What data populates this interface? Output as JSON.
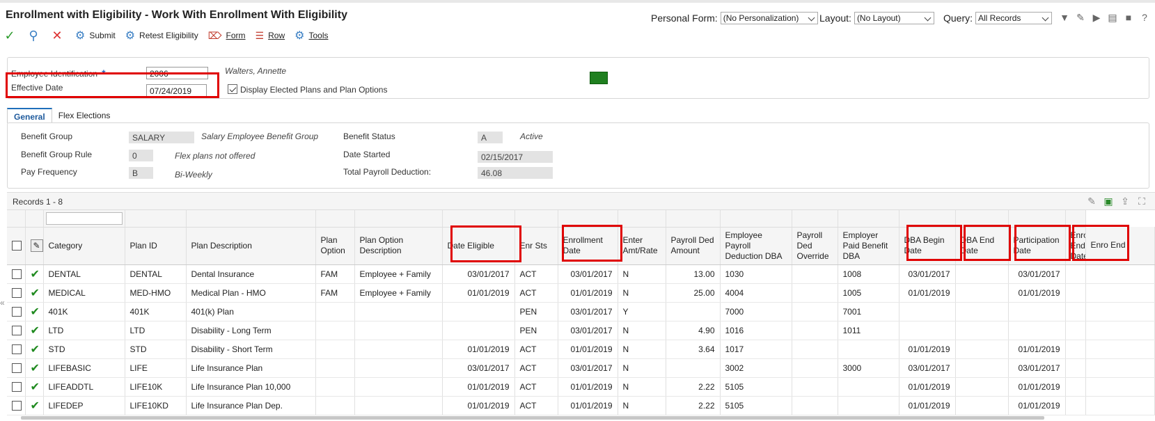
{
  "app": {
    "title": "Enrollment with Eligibility - Work With Enrollment With Eligibility",
    "personal_form_label": "Personal Form:",
    "personal_form_value": "(No Personalization)",
    "layout_label": "Layout:",
    "layout_value": "(No Layout)",
    "query_label": "Query:",
    "query_value": "All Records"
  },
  "toolbar": {
    "submit": "Submit",
    "retest": "Retest Eligibility",
    "form": "Form",
    "row": "Row",
    "tools": "Tools"
  },
  "header": {
    "emp_id_label": "Employee Identification",
    "emp_id_value": "2006",
    "emp_name": "Walters, Annette",
    "eff_date_label": "Effective Date",
    "eff_date_value": "07/24/2019",
    "display_elected_label": "Display Elected Plans and Plan Options"
  },
  "tabs": {
    "general": "General",
    "flex": "Flex Elections"
  },
  "general": {
    "benefit_group_label": "Benefit Group",
    "benefit_group_value": "SALARY",
    "benefit_group_desc": "Salary Employee Benefit Group",
    "benefit_rule_label": "Benefit Group Rule",
    "benefit_rule_value": "0",
    "benefit_rule_desc": "Flex plans not offered",
    "pay_freq_label": "Pay Frequency",
    "pay_freq_value": "B",
    "pay_freq_desc": "Bi-Weekly",
    "benefit_status_label": "Benefit Status",
    "benefit_status_value": "A",
    "benefit_status_desc": "Active",
    "date_started_label": "Date Started",
    "date_started_value": "02/15/2017",
    "total_payroll_label": "Total Payroll Deduction:",
    "total_payroll_value": "46.08"
  },
  "grid": {
    "records_label": "Records 1 - 8",
    "columns": {
      "category": "Category",
      "plan_id": "Plan ID",
      "plan_desc": "Plan Description",
      "plan_option": "Plan Option",
      "plan_option_desc": "Plan Option Description",
      "date_eligible": "Date Eligible",
      "enr_sts": "Enr Sts",
      "enrollment_date": "Enrollment Date",
      "enter_amt": "Enter Amt/Rate",
      "payroll_ded_amt": "Payroll Ded Amount",
      "emp_payroll_dba": "Employee Payroll Deduction DBA",
      "payroll_ded_override": "Payroll Ded Override",
      "employer_paid_dba": "Employer Paid Benefit DBA",
      "dba_begin": "DBA Begin Date",
      "dba_end": "DBA End Date",
      "participation": "Participation Date",
      "enrollment_end": "Enrollment End Date",
      "enrollment_end_cut": "Enro End"
    },
    "rows": [
      {
        "category": "DENTAL",
        "plan_id": "DENTAL",
        "plan_desc": "Dental Insurance",
        "plan_option": "FAM",
        "plan_option_desc": "Employee + Family",
        "date_eligible": "03/01/2017",
        "enr_sts": "ACT",
        "enrollment_date": "03/01/2017",
        "enter_amt": "N",
        "payroll_ded_amt": "13.00",
        "emp_payroll_dba": "1030",
        "payroll_ded_override": "",
        "employer_paid_dba": "1008",
        "dba_begin": "03/01/2017",
        "dba_end": "",
        "participation": "03/01/2017",
        "enrollment_end": ""
      },
      {
        "category": "MEDICAL",
        "plan_id": "MED-HMO",
        "plan_desc": "Medical Plan - HMO",
        "plan_option": "FAM",
        "plan_option_desc": "Employee + Family",
        "date_eligible": "01/01/2019",
        "enr_sts": "ACT",
        "enrollment_date": "01/01/2019",
        "enter_amt": "N",
        "payroll_ded_amt": "25.00",
        "emp_payroll_dba": "4004",
        "payroll_ded_override": "",
        "employer_paid_dba": "1005",
        "dba_begin": "01/01/2019",
        "dba_end": "",
        "participation": "01/01/2019",
        "enrollment_end": ""
      },
      {
        "category": "401K",
        "plan_id": "401K",
        "plan_desc": "401(k) Plan",
        "plan_option": "",
        "plan_option_desc": "",
        "date_eligible": "",
        "enr_sts": "PEN",
        "enrollment_date": "03/01/2017",
        "enter_amt": "Y",
        "payroll_ded_amt": "",
        "emp_payroll_dba": "7000",
        "payroll_ded_override": "",
        "employer_paid_dba": "7001",
        "dba_begin": "",
        "dba_end": "",
        "participation": "",
        "enrollment_end": ""
      },
      {
        "category": "LTD",
        "plan_id": "LTD",
        "plan_desc": "Disability - Long Term",
        "plan_option": "",
        "plan_option_desc": "",
        "date_eligible": "",
        "enr_sts": "PEN",
        "enrollment_date": "03/01/2017",
        "enter_amt": "N",
        "payroll_ded_amt": "4.90",
        "emp_payroll_dba": "1016",
        "payroll_ded_override": "",
        "employer_paid_dba": "1011",
        "dba_begin": "",
        "dba_end": "",
        "participation": "",
        "enrollment_end": ""
      },
      {
        "category": "STD",
        "plan_id": "STD",
        "plan_desc": "Disability - Short Term",
        "plan_option": "",
        "plan_option_desc": "",
        "date_eligible": "01/01/2019",
        "enr_sts": "ACT",
        "enrollment_date": "01/01/2019",
        "enter_amt": "N",
        "payroll_ded_amt": "3.64",
        "emp_payroll_dba": "1017",
        "payroll_ded_override": "",
        "employer_paid_dba": "",
        "dba_begin": "01/01/2019",
        "dba_end": "",
        "participation": "01/01/2019",
        "enrollment_end": ""
      },
      {
        "category": "LIFEBASIC",
        "plan_id": "LIFE",
        "plan_desc": "Life Insurance Plan",
        "plan_option": "",
        "plan_option_desc": "",
        "date_eligible": "03/01/2017",
        "enr_sts": "ACT",
        "enrollment_date": "03/01/2017",
        "enter_amt": "N",
        "payroll_ded_amt": "",
        "emp_payroll_dba": "3002",
        "payroll_ded_override": "",
        "employer_paid_dba": "3000",
        "dba_begin": "03/01/2017",
        "dba_end": "",
        "participation": "03/01/2017",
        "enrollment_end": ""
      },
      {
        "category": "LIFEADDTL",
        "plan_id": "LIFE10K",
        "plan_desc": "Life Insurance Plan 10,000",
        "plan_option": "",
        "plan_option_desc": "",
        "date_eligible": "01/01/2019",
        "enr_sts": "ACT",
        "enrollment_date": "01/01/2019",
        "enter_amt": "N",
        "payroll_ded_amt": "2.22",
        "emp_payroll_dba": "5105",
        "payroll_ded_override": "",
        "employer_paid_dba": "",
        "dba_begin": "01/01/2019",
        "dba_end": "",
        "participation": "01/01/2019",
        "enrollment_end": ""
      },
      {
        "category": "LIFEDEP",
        "plan_id": "LIFE10KD",
        "plan_desc": "Life Insurance Plan Dep.",
        "plan_option": "",
        "plan_option_desc": "",
        "date_eligible": "01/01/2019",
        "enr_sts": "ACT",
        "enrollment_date": "01/01/2019",
        "enter_amt": "N",
        "payroll_ded_amt": "2.22",
        "emp_payroll_dba": "5105",
        "payroll_ded_override": "",
        "employer_paid_dba": "",
        "dba_begin": "01/01/2019",
        "dba_end": "",
        "participation": "01/01/2019",
        "enrollment_end": ""
      }
    ]
  },
  "colors": {
    "highlight": "#e00000",
    "accent": "#1e6fba",
    "check": "#1f8a1f"
  }
}
